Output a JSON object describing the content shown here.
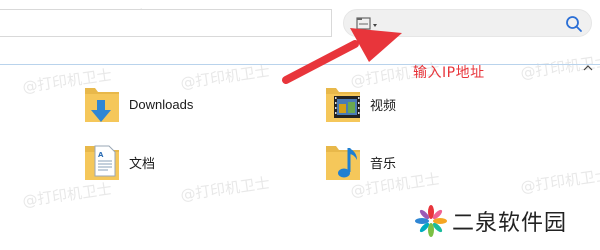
{
  "toolbar": {
    "search_placeholder": ""
  },
  "annotation": {
    "text": "输入IP地址",
    "color": "#e8353b"
  },
  "items": [
    {
      "label": "Downloads",
      "icon": "downloads-folder-icon"
    },
    {
      "label": "视频",
      "icon": "videos-folder-icon"
    },
    {
      "label": "文档",
      "icon": "documents-folder-icon"
    },
    {
      "label": "音乐",
      "icon": "music-folder-icon"
    }
  ],
  "watermark": {
    "text": "@打印机卫士"
  },
  "brand": {
    "name": "二泉软件园"
  },
  "colors": {
    "folder": "#f5c75a",
    "accent": "#1a73e8",
    "header_line": "#b9d3ec"
  }
}
